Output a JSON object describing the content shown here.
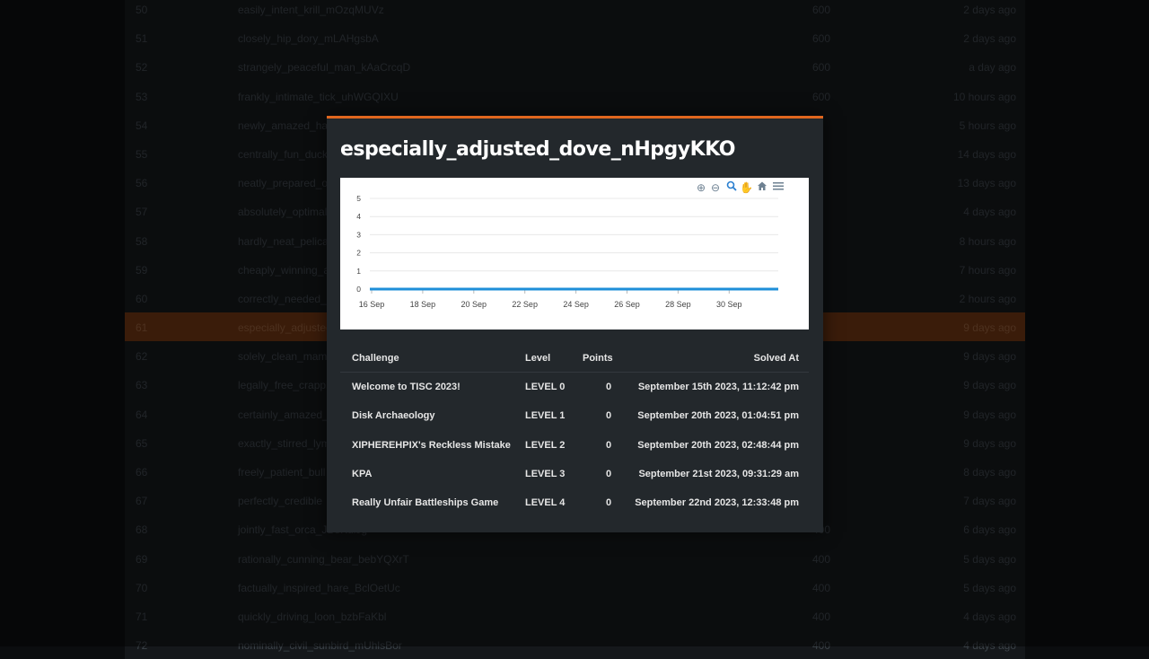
{
  "background_rows": [
    {
      "rank": "50",
      "name": "easily_intent_krill_mOzqMUVz",
      "score": "600",
      "ago": "2 days ago"
    },
    {
      "rank": "51",
      "name": "closely_hip_dory_mLAHgsbA",
      "score": "600",
      "ago": "2 days ago"
    },
    {
      "rank": "52",
      "name": "strangely_peaceful_man_kAaCrcqD",
      "score": "600",
      "ago": "a day ago"
    },
    {
      "rank": "53",
      "name": "frankly_intimate_tick_uhWGQIXU",
      "score": "600",
      "ago": "10 hours ago"
    },
    {
      "rank": "54",
      "name": "newly_amazed_han",
      "score": "",
      "ago": "5 hours ago"
    },
    {
      "rank": "55",
      "name": "centrally_fun_duck",
      "score": "",
      "ago": "14 days ago"
    },
    {
      "rank": "56",
      "name": "neatly_prepared_os",
      "score": "",
      "ago": "13 days ago"
    },
    {
      "rank": "57",
      "name": "absolutely_optimal",
      "score": "",
      "ago": "4 days ago"
    },
    {
      "rank": "58",
      "name": "hardly_neat_pelican",
      "score": "",
      "ago": "8 hours ago"
    },
    {
      "rank": "59",
      "name": "cheaply_winning_a",
      "score": "",
      "ago": "7 hours ago"
    },
    {
      "rank": "60",
      "name": "correctly_needed_s",
      "score": "",
      "ago": "2 hours ago"
    },
    {
      "rank": "61",
      "name": "especially_adjusted",
      "score": "",
      "ago": "9 days ago"
    },
    {
      "rank": "62",
      "name": "solely_clean_mamm",
      "score": "",
      "ago": "9 days ago"
    },
    {
      "rank": "63",
      "name": "legally_free_crappi",
      "score": "",
      "ago": "9 days ago"
    },
    {
      "rank": "64",
      "name": "certainly_amazed_s",
      "score": "",
      "ago": "9 days ago"
    },
    {
      "rank": "65",
      "name": "exactly_stirred_lym",
      "score": "",
      "ago": "9 days ago"
    },
    {
      "rank": "66",
      "name": "freely_patient_bull",
      "score": "",
      "ago": "8 days ago"
    },
    {
      "rank": "67",
      "name": "perfectly_credible",
      "score": "",
      "ago": "7 days ago"
    },
    {
      "rank": "68",
      "name": "jointly_fast_orca_JBeKuiJg",
      "score": "400",
      "ago": "6 days ago"
    },
    {
      "rank": "69",
      "name": "rationally_cunning_bear_bebYQXrT",
      "score": "400",
      "ago": "5 days ago"
    },
    {
      "rank": "70",
      "name": "factually_inspired_hare_BclOetUc",
      "score": "400",
      "ago": "5 days ago"
    },
    {
      "rank": "71",
      "name": "quickly_driving_loon_bzbFaKbl",
      "score": "400",
      "ago": "4 days ago"
    },
    {
      "rank": "72",
      "name": "nominally_civil_sunbird_mUhlsBor",
      "score": "400",
      "ago": "4 days ago"
    }
  ],
  "modal": {
    "title": "especially_adjusted_dove_nHpgyKKO"
  },
  "toolbar_icons": [
    "zoom-in-icon",
    "zoom-out-icon",
    "magnifier-icon",
    "pan-hand-icon",
    "home-icon",
    "menu-icon"
  ],
  "chart_data": {
    "type": "line",
    "x_tick_labels": [
      "16 Sep",
      "18 Sep",
      "20 Sep",
      "22 Sep",
      "24 Sep",
      "26 Sep",
      "28 Sep",
      "30 Sep"
    ],
    "y_tick_labels": [
      "0",
      "1",
      "2",
      "3",
      "4",
      "5"
    ],
    "ylim": [
      0,
      5
    ],
    "series": [
      {
        "values": [
          0,
          0,
          0,
          0,
          0,
          0,
          0,
          0,
          0,
          0,
          0,
          0,
          0,
          0,
          0,
          0,
          0
        ],
        "color": "#1e8fd8"
      }
    ],
    "grid": true,
    "title": "",
    "xlabel": "",
    "ylabel": ""
  },
  "table": {
    "headers": {
      "challenge": "Challenge",
      "level": "Level",
      "points": "Points",
      "solved_at": "Solved At"
    },
    "rows": [
      {
        "challenge": "Welcome to TISC 2023!",
        "level": "LEVEL 0",
        "points": "0",
        "solved_at": "September 15th 2023, 11:12:42 pm"
      },
      {
        "challenge": "Disk Archaeology",
        "level": "LEVEL 1",
        "points": "0",
        "solved_at": "September 20th 2023, 01:04:51 pm"
      },
      {
        "challenge": "XIPHEREHPIX's Reckless Mistake",
        "level": "LEVEL 2",
        "points": "0",
        "solved_at": "September 20th 2023, 02:48:44 pm"
      },
      {
        "challenge": "KPA",
        "level": "LEVEL 3",
        "points": "0",
        "solved_at": "September 21st 2023, 09:31:29 am"
      },
      {
        "challenge": "Really Unfair Battleships Game",
        "level": "LEVEL 4",
        "points": "0",
        "solved_at": "September 22nd 2023, 12:33:48 pm"
      }
    ]
  },
  "colors": {
    "accent": "#e0661e",
    "series": "#1e8fd8",
    "modal_bg": "#23282c"
  }
}
